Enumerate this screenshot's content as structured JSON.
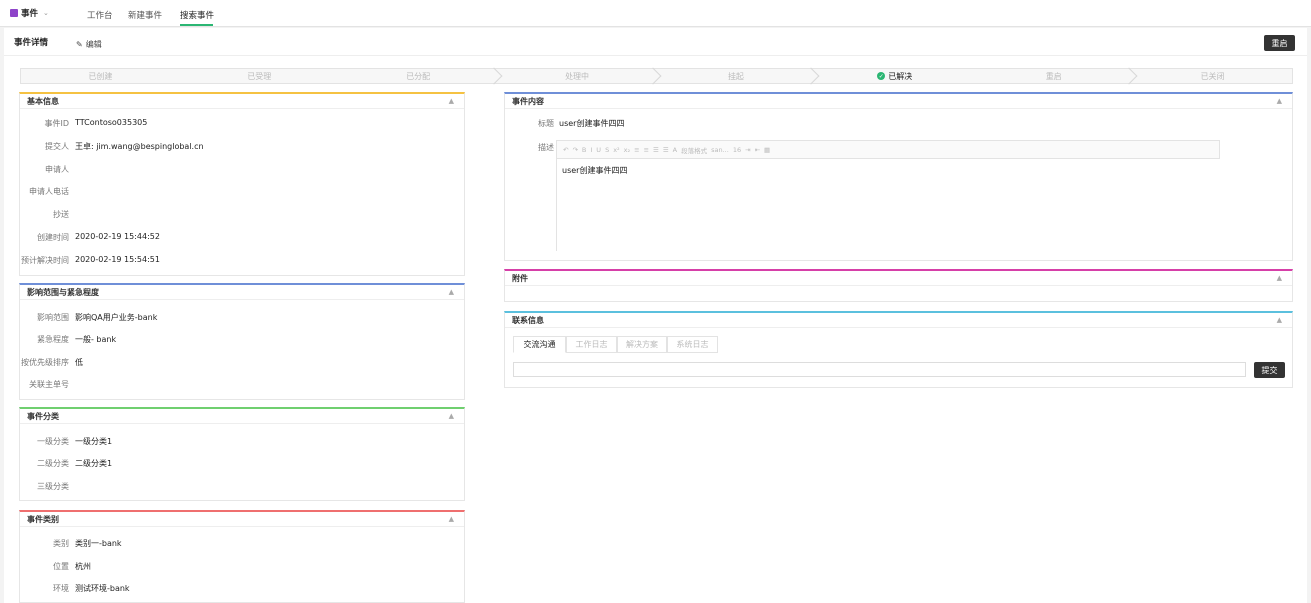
{
  "nav": {
    "app_name": "事件",
    "links": [
      "工作台",
      "新建事件",
      "搜索事件"
    ]
  },
  "page": {
    "title": "事件详情",
    "edit_label": "编辑",
    "reopen_label": "重启"
  },
  "steps": [
    "已创建",
    "已受理",
    "已分配",
    "处理中",
    "挂起",
    "已解决",
    "重启",
    "已关闭"
  ],
  "basic": {
    "title": "基本信息",
    "fields": [
      {
        "label": "事件ID",
        "value": "TTContoso035305"
      },
      {
        "label": "提交人",
        "value": "王卓: jim.wang@bespinglobal.cn"
      },
      {
        "label": "申请人",
        "value": ""
      },
      {
        "label": "申请人电话",
        "value": ""
      },
      {
        "label": "抄送",
        "value": ""
      },
      {
        "label": "创建时间",
        "value": "2020-02-19 15:44:52"
      },
      {
        "label": "预计解决时间",
        "value": "2020-02-19 15:54:51"
      }
    ]
  },
  "impact": {
    "title": "影响范围与紧急程度",
    "fields": [
      {
        "label": "影响范围",
        "value": "影响QA用户业务-bank"
      },
      {
        "label": "紧急程度",
        "value": "一般- bank"
      },
      {
        "label": "按优先级排序",
        "value": "低"
      },
      {
        "label": "关联主单号",
        "value": ""
      }
    ]
  },
  "category": {
    "title": "事件分类",
    "fields": [
      {
        "label": "一级分类",
        "value": "一级分类1"
      },
      {
        "label": "二级分类",
        "value": "二级分类1"
      },
      {
        "label": "三级分类",
        "value": ""
      }
    ]
  },
  "type": {
    "title": "事件类别",
    "fields": [
      {
        "label": "类别",
        "value": "类别一-bank"
      },
      {
        "label": "位置",
        "value": "杭州"
      },
      {
        "label": "环境",
        "value": "测试环境-bank"
      }
    ]
  },
  "content": {
    "title": "事件内容",
    "subject_label": "标题",
    "subject_value": "user创建事件四四",
    "desc_label": "描述",
    "desc_value": "user创建事件四四",
    "toolbar": {
      "format": "段落格式",
      "font": "san...",
      "size": "16"
    }
  },
  "attachment": {
    "title": "附件"
  },
  "contact": {
    "title": "联系信息",
    "tabs": [
      "交流沟通",
      "工作日志",
      "解决方案",
      "系统日志"
    ],
    "submit_label": "提交"
  },
  "colors": {
    "basic": "#f5c242",
    "impact": "#6f8fd8",
    "category": "#6fcf6f",
    "type": "#ef6f6f",
    "content": "#6f8fd8",
    "attachment": "#d63fa8",
    "contact": "#5bc0de",
    "accent": "#2bb673"
  },
  "icons": {
    "collapse": "chevron-up-icon",
    "edit": "pencil-icon",
    "check": "check-circle-icon"
  }
}
